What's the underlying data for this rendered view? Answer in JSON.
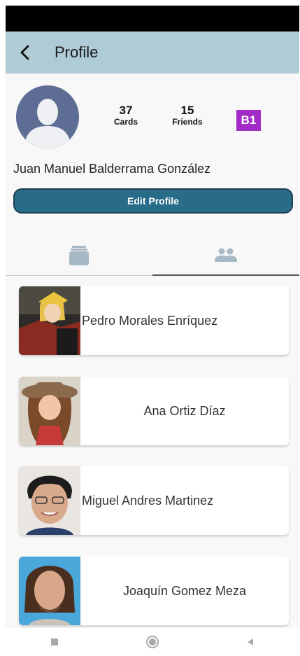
{
  "app_bar": {
    "title": "Profile",
    "back_icon": "chevron-left-icon"
  },
  "profile": {
    "full_name": "Juan Manuel Balderrama González",
    "stats": {
      "cards_count": "37",
      "cards_label": "Cards",
      "friends_count": "15",
      "friends_label": "Friends"
    },
    "level_badge": "B1",
    "edit_button_label": "Edit Profile"
  },
  "tabs": [
    {
      "icon": "cards-stack-icon",
      "active": false
    },
    {
      "icon": "people-icon",
      "active": true
    }
  ],
  "friends": [
    {
      "name": "Pedro Morales Enríquez"
    },
    {
      "name": "Ana Ortiz Díaz"
    },
    {
      "name": "Miguel Andres Martinez"
    },
    {
      "name": "Joaquín Gomez Meza"
    }
  ],
  "colors": {
    "app_bar": "#aecbd6",
    "edit_button": "#296c89",
    "badge": "#a22cc6",
    "avatar": "#5e6d93"
  },
  "nav_bar": {
    "icons": [
      "square-icon",
      "circle-icon",
      "triangle-back-icon"
    ]
  }
}
